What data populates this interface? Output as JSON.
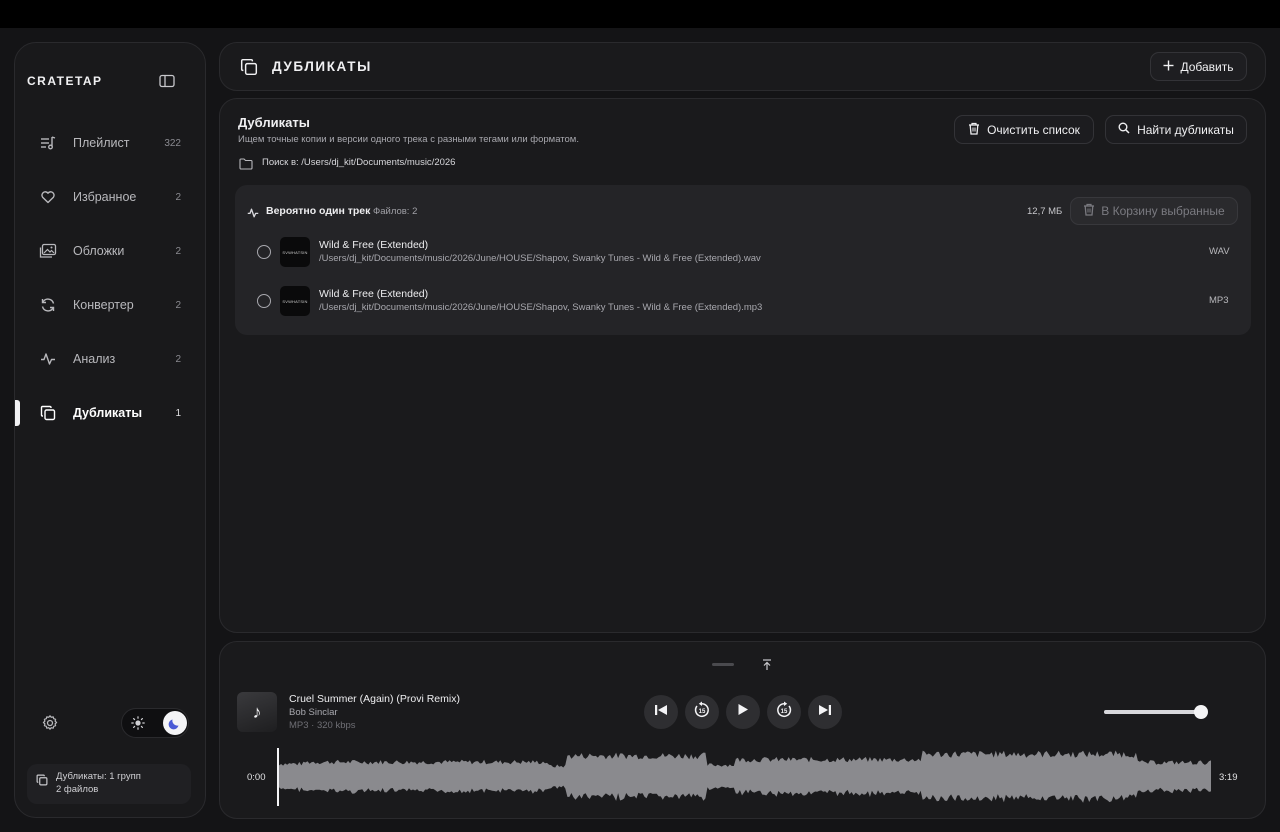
{
  "sidebar": {
    "brand": "CRATETAP",
    "items": [
      {
        "label": "Плейлист",
        "count": "322",
        "icon": "playlist-icon"
      },
      {
        "label": "Избранное",
        "count": "2",
        "icon": "heart-icon"
      },
      {
        "label": "Обложки",
        "count": "2",
        "icon": "covers-icon"
      },
      {
        "label": "Конвертер",
        "count": "2",
        "icon": "convert-icon"
      },
      {
        "label": "Анализ",
        "count": "2",
        "icon": "pulse-icon"
      },
      {
        "label": "Дубликаты",
        "count": "1",
        "icon": "duplicates-icon"
      }
    ],
    "active_item": "Дубликаты",
    "status": {
      "line1": "Дубликаты: 1 групп",
      "line2": "2 файлов"
    }
  },
  "header": {
    "title": "ДУБЛИКАТЫ",
    "add_label": "Добавить"
  },
  "main": {
    "title": "Дубликаты",
    "subtitle": "Ищем точные копии и версии одного трека с разными тегами или форматом.",
    "search_path": "Поиск в: /Users/dj_kit/Documents/music/2026",
    "clear_label": "Очистить список",
    "find_label": "Найти дубликаты",
    "group": {
      "title": "Вероятно один трек",
      "count_label": "Файлов: 2",
      "size": "12,7 МБ",
      "trash_label": "В Корзину выбранные",
      "files": [
        {
          "name": "Wild & Free (Extended)",
          "path": "/Users/dj_kit/Documents/music/2026/June/HOUSE/Shapov, Swanky Tunes - Wild & Free (Extended).wav",
          "format": "WAV",
          "thumb": "SVWHATSIN",
          "selected": false
        },
        {
          "name": "Wild & Free (Extended)",
          "path": "/Users/dj_kit/Documents/music/2026/June/HOUSE/Shapov, Swanky Tunes - Wild & Free (Extended).mp3",
          "format": "MP3",
          "thumb": "SVWHATSIN",
          "selected": false
        }
      ]
    }
  },
  "player": {
    "title": "Cruel Summer (Again) (Provi Remix)",
    "artist": "Bob Sinclar",
    "meta": "MP3 · 320 kbps",
    "time_current": "0:00",
    "time_total": "3:19",
    "volume": 0.95,
    "progress": 0.0,
    "cover_icon": "music-note-icon"
  },
  "theme": {
    "mode": "dark",
    "accent": "#4b5bd6"
  }
}
